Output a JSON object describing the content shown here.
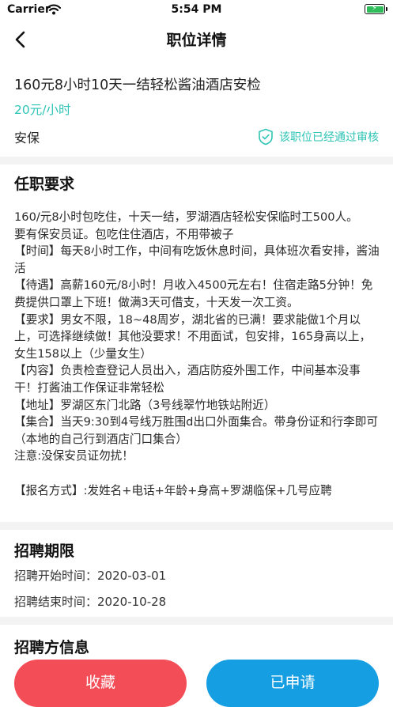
{
  "status_bar": {
    "carrier": "Carrier",
    "time": "5:54 PM"
  },
  "nav": {
    "title": "职位详情"
  },
  "job": {
    "title": "160元8小时10天一结轻松酱油酒店安检",
    "salary": "20元/小时",
    "category": "安保",
    "verified_text": "该职位已经通过审核"
  },
  "requirements": {
    "heading": "任职要求",
    "lines": [
      "160/元8小时包吃住，十天一结，罗湖酒店轻松安保临时工500人。",
      "要有保安员证。包吃住住酒店，不用带被子",
      "【时间】每天8小时工作，中间有吃饭休息时间，具体班次看安排，酱油活",
      "【待遇】高薪160元/8小时！月收入4500元左右！住宿走路5分钟！免费提供口罩上下班！做满3天可借支，十天发一次工资。",
      "【要求】男女不限，18~48周岁，湖北省的已满！要求能做1个月以上，可选择继续做！其他没要求！不用面试，包安排，165身高以上，女生158以上（少量女生）",
      "【内容】负责检查登记人员出入，酒店防疫外围工作，中间基本没事干！打酱油工作保证非常轻松",
      "【地址】罗湖区东门北路（3号线翠竹地铁站附近）",
      "【集合】当天9:30到4号线万胜围d出口外面集合。带身份证和行李即可（本地的自己行到酒店门口集合）",
      "注意:没保安员证勿扰！",
      "",
      "【报名方式】:发姓名+电话+年龄+身高+罗湖临保+几号应聘"
    ]
  },
  "period": {
    "heading": "招聘期限",
    "start_label": "招聘开始时间：",
    "start_date": "2020-03-01",
    "end_label": "招聘结束时间：",
    "end_date": "2020-10-28"
  },
  "employer": {
    "heading": "招聘方信息"
  },
  "actions": {
    "favorite_label": "收藏",
    "applied_label": "已申请"
  },
  "colors": {
    "accent_teal": "#2ec4b6",
    "favorite_red": "#f34d57",
    "applied_blue": "#159ee2",
    "battery_green": "#2ebd5a"
  }
}
